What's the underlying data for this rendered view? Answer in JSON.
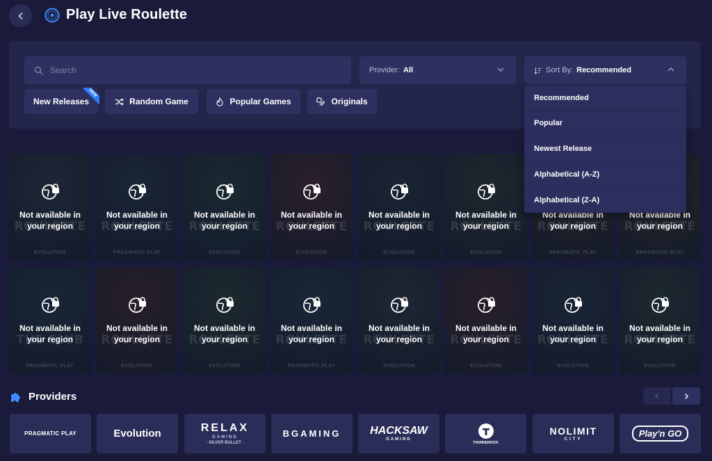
{
  "header": {
    "title": "Play Live Roulette",
    "back_icon": "chevron-left-icon",
    "title_icon": "roulette-wheel-icon"
  },
  "filters": {
    "search_placeholder": "Search",
    "provider_label": "Provider:",
    "provider_value": "All",
    "sort_label": "Sort By:",
    "sort_value": "Recommended",
    "chips": [
      {
        "label": "New Releases",
        "badge": "NEW",
        "icon": ""
      },
      {
        "label": "Random Game",
        "icon": "shuffle-icon"
      },
      {
        "label": "Popular Games",
        "icon": "fire-icon"
      },
      {
        "label": "Originals",
        "icon": "originals-icon"
      }
    ]
  },
  "sort_dropdown": {
    "options": [
      "Recommended",
      "Popular",
      "Newest Release",
      "Alphabetical (A-Z)",
      "Alphabetical (Z-A)"
    ]
  },
  "games": {
    "unavailable_text_line1": "Not available in",
    "unavailable_text_line2": "your region",
    "items": [
      {
        "name": "ROULETTE",
        "provider": "EVOLUTION",
        "color": "#2b3a44"
      },
      {
        "name": "ROULETTE",
        "provider": "PRAGMATIC PLAY",
        "color": "#24364a"
      },
      {
        "name": "ROULETTE",
        "provider": "EVOLUTION",
        "color": "#23403e"
      },
      {
        "name": "ROULETTE",
        "provider": "EVOLUTION",
        "color": "#4a2a2e"
      },
      {
        "name": "ROULETTE",
        "provider": "EVOLUTION",
        "color": "#26343f"
      },
      {
        "name": "ROULETTE",
        "provider": "EVOLUTION",
        "color": "#2d3c36"
      },
      {
        "name": "ROULETTE",
        "provider": "PRAGMATIC PLAY",
        "color": "#3a2f24"
      },
      {
        "name": "ROULETTE",
        "provider": "PRAGMATIC PLAY",
        "color": "#3a3424"
      },
      {
        "name": "THE CLUB",
        "provider": "PRAGMATIC PLAY",
        "color": "#22384a"
      },
      {
        "name": "ROULETTE",
        "provider": "EVOLUTION",
        "color": "#42282a"
      },
      {
        "name": "ROULETTE",
        "provider": "EVOLUTION",
        "color": "#2a4038"
      },
      {
        "name": "ROULETTE",
        "provider": "PRAGMATIC PLAY",
        "color": "#243a48"
      },
      {
        "name": "ROULETTE",
        "provider": "EVOLUTION",
        "color": "#2f3840"
      },
      {
        "name": "ROULETTE",
        "provider": "EVOLUTION",
        "color": "#442a2e"
      },
      {
        "name": "ROULETTE",
        "provider": "EVOLUTION",
        "color": "#23364a"
      },
      {
        "name": "ROULETTE",
        "provider": "EVOLUTION",
        "color": "#2a3e3a"
      }
    ]
  },
  "providers": {
    "title": "Providers",
    "icon": "puzzle-icon",
    "items": [
      {
        "name": "PRAGMATIC PLAY"
      },
      {
        "name": "Evolution"
      },
      {
        "name": "RELAX",
        "sub1": "GAMING",
        "sub2": "· SILVER BULLET ·"
      },
      {
        "name": "BGAMING"
      },
      {
        "name": "HACKSAW",
        "sub1": "GAMING"
      },
      {
        "name": "THUNDERKICK"
      },
      {
        "name": "NOLIMIT",
        "sub1": "CITY"
      },
      {
        "name": "Play'n GO"
      }
    ]
  },
  "colors": {
    "background": "#1a1b3a",
    "panel": "#23254a",
    "control": "#2e3160",
    "accent": "#2f7cf6"
  }
}
